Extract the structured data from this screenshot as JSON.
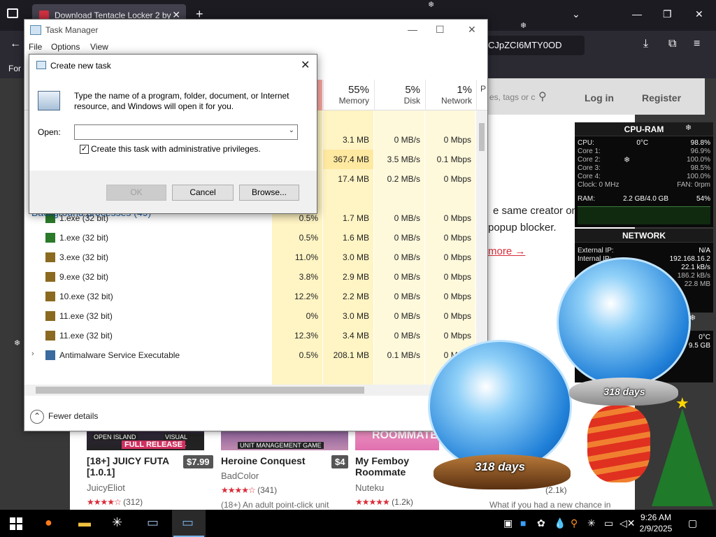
{
  "browser": {
    "tab_title": "Download Tentacle Locker 2 by",
    "url_fragment": "CJpZCI6MTY0OD",
    "bookmark_label": "For c"
  },
  "site": {
    "search_placeholder": "es, tags or c",
    "login": "Log in",
    "register": "Register",
    "promo_line_1": "e same creator on th",
    "promo_line_2": "popup blocker.",
    "more_link": "more →",
    "games": [
      {
        "title": "[18+] JUICY FUTA [1.0.1]",
        "price": "$7.99",
        "author": "JuicyEliot",
        "rating": "(312)",
        "tag1": "OPEN ISLAND",
        "tag2": "VISUAL NOVEL",
        "banner": "FULL RELEASE"
      },
      {
        "title": "Heroine Conquest",
        "price": "$4",
        "author": "BadColor",
        "rating": "(341)",
        "desc": "(18+) An adult point-click unit",
        "banner": "UNIT MANAGEMENT GAME"
      },
      {
        "title": "My Femboy Roommate",
        "price": "",
        "author": "Nuteku",
        "rating": "(1.2k)",
        "banner": "ROOMMATE"
      },
      {
        "title": "",
        "price": "",
        "author": "",
        "rating": "(2.1k)",
        "desc": "What if you had a new chance in",
        "banner": "eye"
      }
    ]
  },
  "task_manager": {
    "title": "Task Manager",
    "menu": [
      "File",
      "Options",
      "View"
    ],
    "columns": [
      {
        "pct": "55%",
        "label": "Memory"
      },
      {
        "pct": "5%",
        "label": "Disk"
      },
      {
        "pct": "1%",
        "label": "Network"
      },
      {
        "pct": "",
        "label": "P"
      }
    ],
    "top_rows": [
      {
        "cpu": "",
        "mem": "3.1 MB",
        "disk": "0 MB/s",
        "net": "0 Mbps"
      },
      {
        "cpu": "",
        "mem": "367.4 MB",
        "disk": "3.5 MB/s",
        "net": "0.1 Mbps"
      },
      {
        "cpu": "",
        "mem": "17.4 MB",
        "disk": "0.2 MB/s",
        "net": "0 Mbps"
      }
    ],
    "group_header": "Background processes (49)",
    "processes": [
      {
        "name": "1.exe (32 bit)",
        "cpu": "0.5%",
        "mem": "1.7 MB",
        "disk": "0 MB/s",
        "net": "0 Mbps"
      },
      {
        "name": "1.exe (32 bit)",
        "cpu": "0.5%",
        "mem": "1.6 MB",
        "disk": "0 MB/s",
        "net": "0 Mbps"
      },
      {
        "name": "3.exe (32 bit)",
        "cpu": "11.0%",
        "mem": "3.0 MB",
        "disk": "0 MB/s",
        "net": "0 Mbps"
      },
      {
        "name": "9.exe (32 bit)",
        "cpu": "3.8%",
        "mem": "2.9 MB",
        "disk": "0 MB/s",
        "net": "0 Mbps"
      },
      {
        "name": "10.exe (32 bit)",
        "cpu": "12.2%",
        "mem": "2.2 MB",
        "disk": "0 MB/s",
        "net": "0 Mbps"
      },
      {
        "name": "11.exe (32 bit)",
        "cpu": "0%",
        "mem": "3.0 MB",
        "disk": "0 MB/s",
        "net": "0 Mbps"
      },
      {
        "name": "11.exe (32 bit)",
        "cpu": "12.3%",
        "mem": "3.4 MB",
        "disk": "0 MB/s",
        "net": "0 Mbps"
      },
      {
        "name": "Antimalware Service Executable",
        "cpu": "0.5%",
        "mem": "208.1 MB",
        "disk": "0.1 MB/s",
        "net": "0 Mbps"
      }
    ],
    "fewer_details": "Fewer details"
  },
  "dialog": {
    "title": "Create new task",
    "description": "Type the name of a program, folder, document, or Internet resource, and Windows will open it for you.",
    "open_label": "Open:",
    "open_value": "",
    "admin_checkbox_label": "Create this task with administrative privileges.",
    "admin_checked": true,
    "ok": "OK",
    "cancel": "Cancel",
    "browse": "Browse..."
  },
  "widgets": {
    "cpu_ram": {
      "title": "CPU-RAM",
      "cpu_label": "CPU:",
      "cpu_temp": "0°C",
      "cpu_pct": "98.8%",
      "cores": [
        {
          "label": "Core 1:",
          "value": "96.9%"
        },
        {
          "label": "Core 2:",
          "value": "100.0%"
        },
        {
          "label": "Core 3:",
          "value": "98.5%"
        },
        {
          "label": "Core 4:",
          "value": "100.0%"
        }
      ],
      "clock": "Clock: 0 MHz",
      "fan": "FAN: 0rpm",
      "ram_label": "RAM:",
      "ram_value": "2.2 GB/4.0 GB",
      "ram_pct": "54%"
    },
    "network": {
      "title": "NETWORK",
      "external_ip_label": "External IP:",
      "external_ip": "N/A",
      "internal_ip_label": "Internal IP:",
      "internal_ip": "192.168.16.2",
      "up": "22.1 kB/s",
      "down": "186.2 kB/s",
      "total": "22.8 MB"
    },
    "disk": {
      "temp": "0°C",
      "size": "9.5 GB"
    }
  },
  "decorations": {
    "globe_days": "318 days",
    "globe_days_small": "318 days"
  },
  "taskbar": {
    "time": "9:26 AM",
    "date": "2/9/2025"
  },
  "colors": {
    "accent_link": "#da2c38",
    "tm_cpu_fill": "#fff4c4",
    "tm_io_fill": "#fff9dc",
    "group_header": "#1a5fa8"
  }
}
